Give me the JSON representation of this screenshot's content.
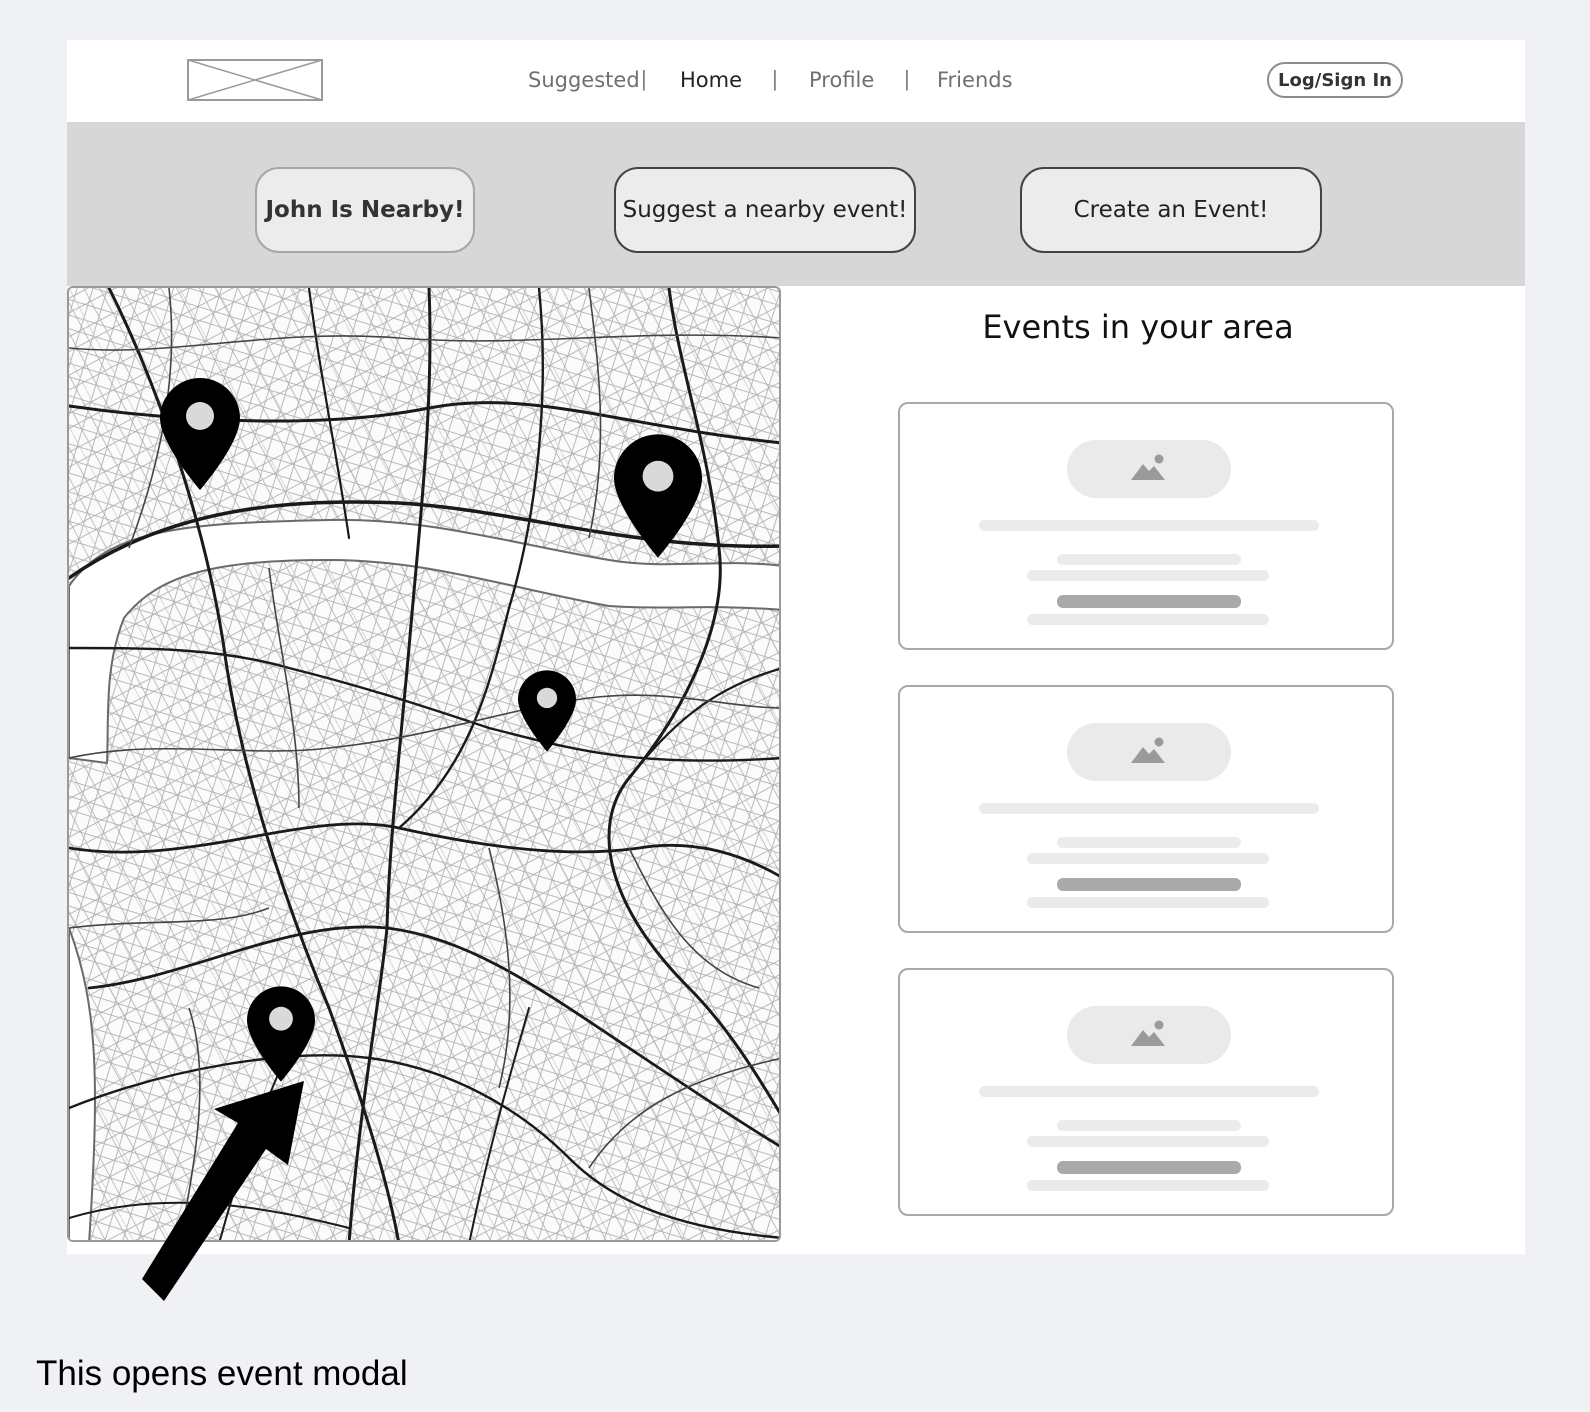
{
  "nav": {
    "links": [
      {
        "label": "Suggested"
      },
      {
        "label": "Home"
      },
      {
        "label": "Profile"
      },
      {
        "label": "Friends"
      }
    ],
    "separator": "|",
    "login_label": "Log/Sign In"
  },
  "actions": {
    "john_nearby": "John Is Nearby!",
    "suggest_event": "Suggest a nearby event!",
    "create_event": "Create an Event!"
  },
  "events": {
    "title": "Events in your area",
    "cards": [
      {
        "image_icon": "image-placeholder-icon"
      },
      {
        "image_icon": "image-placeholder-icon"
      },
      {
        "image_icon": "image-placeholder-icon"
      }
    ]
  },
  "map": {
    "pins": [
      {
        "icon": "map-pin-icon"
      },
      {
        "icon": "map-pin-icon"
      },
      {
        "icon": "map-pin-icon"
      },
      {
        "icon": "map-pin-icon"
      }
    ]
  },
  "annotation": {
    "text": "This opens event modal",
    "arrow_icon": "arrow-icon"
  },
  "colors": {
    "page_bg": "#f0f1f5",
    "band_bg": "#d7d7d7",
    "button_bg": "#ececec",
    "pin": "#000000"
  }
}
